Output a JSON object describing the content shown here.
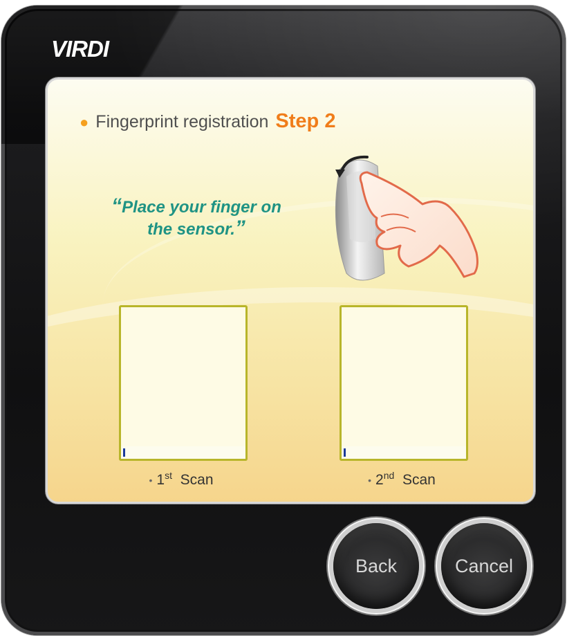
{
  "brand": {
    "logo": "VIRDI"
  },
  "registration": {
    "label": "Fingerprint registration",
    "step": "Step 2"
  },
  "instruction": {
    "open_quote": "“",
    "text": "Place your finger on the sensor.",
    "close_quote": "”"
  },
  "scans": [
    {
      "num": "1",
      "suffix": "st",
      "word": "Scan",
      "progress": 0.0
    },
    {
      "num": "2",
      "suffix": "nd",
      "word": "Scan",
      "progress": 0.0
    }
  ],
  "buttons": {
    "back": "Back",
    "cancel": "Cancel"
  },
  "colors": {
    "accent_orange": "#f07d1a",
    "bullet_orange": "#f5a01e",
    "instruction_teal": "#1f9384",
    "scan_border": "#b8b52a",
    "progress_fill": "#1a3a9a"
  }
}
